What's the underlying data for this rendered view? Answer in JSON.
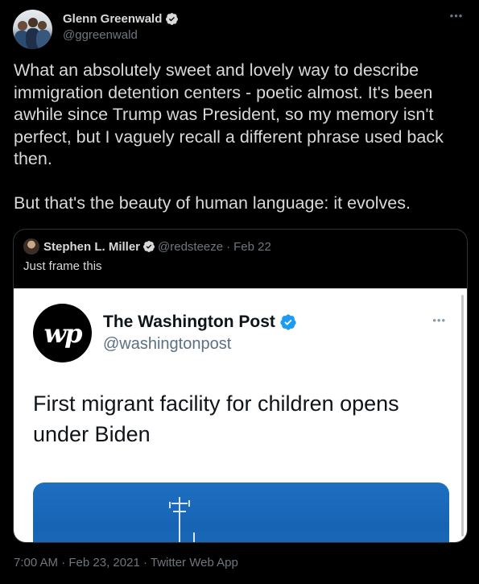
{
  "author": {
    "display_name": "Glenn Greenwald",
    "handle": "@ggreenwald"
  },
  "more_icon": "more-horizontal-icon",
  "tweet_text": "What an absolutely sweet and lovely way to describe immigration detention centers - poetic almost. It's been awhile since Trump was President, so my memory isn't perfect, but I vaguely recall a different phrase used back then.\n\nBut that's the beauty of human language: it evolves.",
  "quoted_tweet": {
    "display_name": "Stephen L. Miller",
    "handle": "@redsteeze",
    "separator": "·",
    "date": "Feb 22",
    "text": "Just frame this",
    "media": {
      "logo_text": "wp",
      "account_name": "The Washington Post",
      "account_handle": "@washingtonpost",
      "headline": "First migrant facility for children opens under Biden"
    }
  },
  "footer": {
    "time": "7:00 AM",
    "separator": "·",
    "date": "Feb 23, 2021",
    "app": "Twitter Web App"
  },
  "colors": {
    "background": "#000000",
    "verified_blue": "#1d9bf0",
    "muted": "#6e767d",
    "border": "#2f3336"
  }
}
